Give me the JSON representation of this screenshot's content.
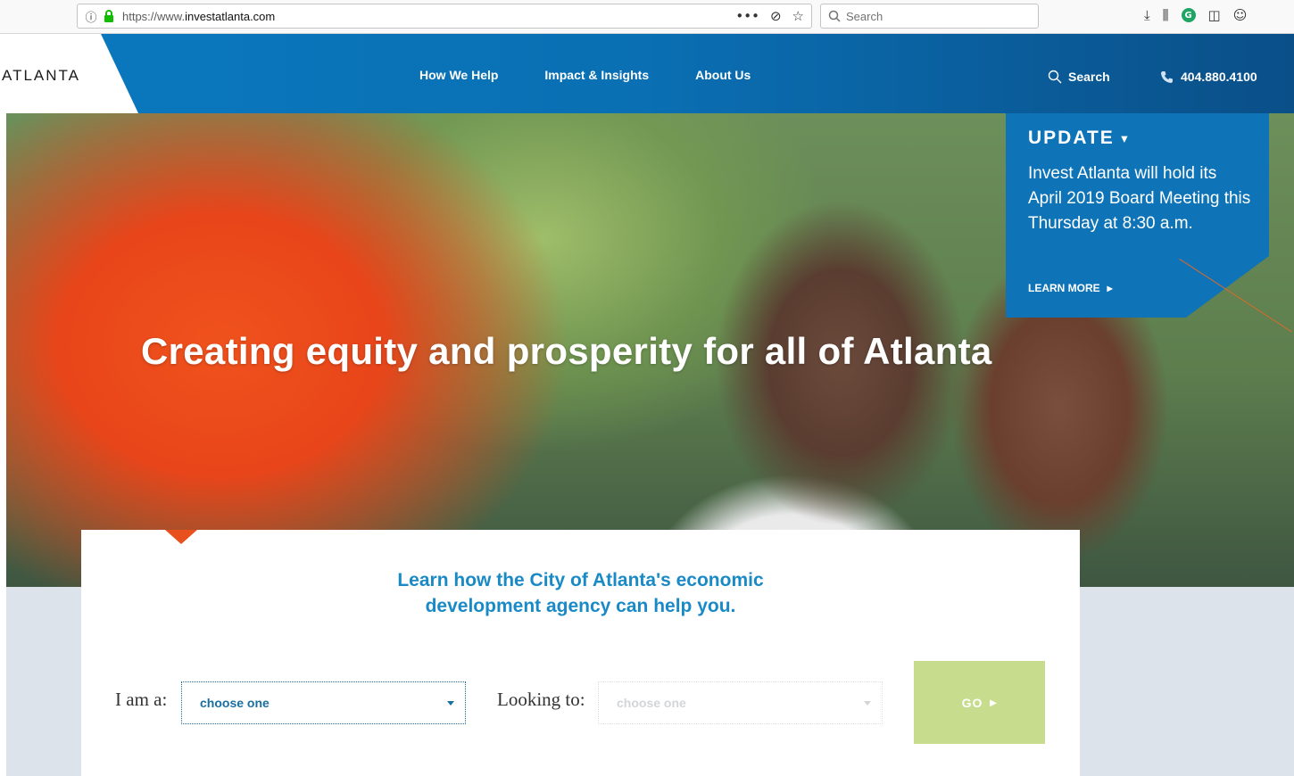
{
  "browser": {
    "url_prefix": "https://www.",
    "url_domain": "investatlanta.com",
    "info_glyph": "ⓘ",
    "page_actions": [
      "•••",
      "⊘",
      "☆"
    ],
    "search_placeholder": "Search",
    "toolbar_glyphs": [
      "⤓",
      "⫼",
      "◫",
      "☺"
    ],
    "ext_letter": "G"
  },
  "header": {
    "logo": "ATLANTA",
    "nav": [
      "How We Help",
      "Impact & Insights",
      "About Us"
    ],
    "search_label": "Search",
    "phone": "404.880.4100"
  },
  "hero": {
    "title": "Creating equity and prosperity for all of Atlanta"
  },
  "update": {
    "heading": "UPDATE",
    "caret": "▾",
    "body": "Invest Atlanta will hold its April 2019 Board Meeting this Thursday at 8:30 a.m.",
    "link": "LEARN MORE",
    "link_arrow": "▸"
  },
  "finder": {
    "heading_line1": "Learn how the City of Atlanta's economic",
    "heading_line2": "development agency can help you.",
    "i_am_label": "I am a:",
    "i_am_value": "choose one",
    "looking_label": "Looking to:",
    "looking_value": "choose one",
    "go_label": "GO",
    "go_arrow": "▸"
  },
  "colors": {
    "brand_blue": "#0a79bf",
    "accent_orange": "#e8501d",
    "go_green": "#c8dc8e",
    "heading_blue": "#1a8ac7"
  }
}
